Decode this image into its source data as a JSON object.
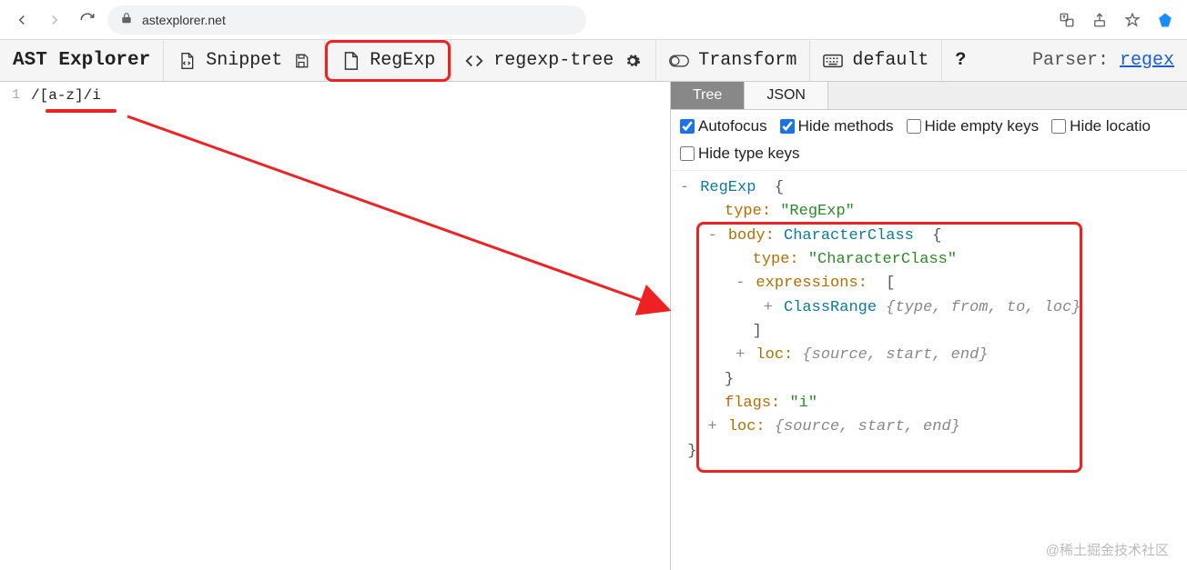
{
  "chrome": {
    "url": "astexplorer.net"
  },
  "toolbar": {
    "logo": "AST Explorer",
    "snippet": "Snippet",
    "regexp": "RegExp",
    "regexptree": "regexp-tree",
    "transform": "Transform",
    "default": "default",
    "parser_label": "Parser: ",
    "parser_link": "regex"
  },
  "editor": {
    "line_no": "1",
    "code": "/[a-z]/i"
  },
  "tabs": {
    "tree": "Tree",
    "json": "JSON"
  },
  "opts": {
    "autofocus": "Autofocus",
    "hide_methods": "Hide methods",
    "hide_empty": "Hide empty keys",
    "hide_location": "Hide locatio",
    "hide_type": "Hide type keys"
  },
  "tree": {
    "root_type": "RegExp",
    "type_key": "type:",
    "type_val": "\"RegExp\"",
    "body_key": "body:",
    "body_type": "CharacterClass",
    "body_type_val": "\"CharacterClass\"",
    "expr_key": "expressions:",
    "classrange": "ClassRange",
    "classrange_summary": "{type, from, to, loc}",
    "loc_key": "loc:",
    "loc_summary": "{source, start, end}",
    "flags_key": "flags:",
    "flags_val": "\"i\"",
    "open_brace": "{",
    "close_brace": "}",
    "open_bracket": "[",
    "close_bracket": "]"
  },
  "watermark": "@稀土掘金技术社区"
}
